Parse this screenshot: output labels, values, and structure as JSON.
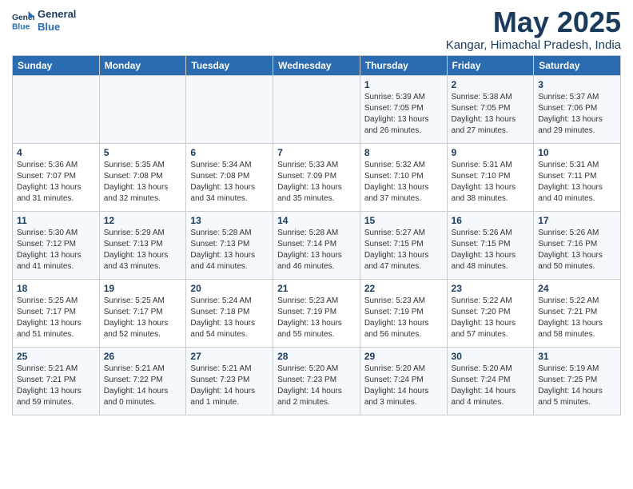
{
  "logo": {
    "line1": "General",
    "line2": "Blue"
  },
  "title": "May 2025",
  "location": "Kangar, Himachal Pradesh, India",
  "weekdays": [
    "Sunday",
    "Monday",
    "Tuesday",
    "Wednesday",
    "Thursday",
    "Friday",
    "Saturday"
  ],
  "weeks": [
    [
      {
        "day": "",
        "info": ""
      },
      {
        "day": "",
        "info": ""
      },
      {
        "day": "",
        "info": ""
      },
      {
        "day": "",
        "info": ""
      },
      {
        "day": "1",
        "info": "Sunrise: 5:39 AM\nSunset: 7:05 PM\nDaylight: 13 hours\nand 26 minutes."
      },
      {
        "day": "2",
        "info": "Sunrise: 5:38 AM\nSunset: 7:05 PM\nDaylight: 13 hours\nand 27 minutes."
      },
      {
        "day": "3",
        "info": "Sunrise: 5:37 AM\nSunset: 7:06 PM\nDaylight: 13 hours\nand 29 minutes."
      }
    ],
    [
      {
        "day": "4",
        "info": "Sunrise: 5:36 AM\nSunset: 7:07 PM\nDaylight: 13 hours\nand 31 minutes."
      },
      {
        "day": "5",
        "info": "Sunrise: 5:35 AM\nSunset: 7:08 PM\nDaylight: 13 hours\nand 32 minutes."
      },
      {
        "day": "6",
        "info": "Sunrise: 5:34 AM\nSunset: 7:08 PM\nDaylight: 13 hours\nand 34 minutes."
      },
      {
        "day": "7",
        "info": "Sunrise: 5:33 AM\nSunset: 7:09 PM\nDaylight: 13 hours\nand 35 minutes."
      },
      {
        "day": "8",
        "info": "Sunrise: 5:32 AM\nSunset: 7:10 PM\nDaylight: 13 hours\nand 37 minutes."
      },
      {
        "day": "9",
        "info": "Sunrise: 5:31 AM\nSunset: 7:10 PM\nDaylight: 13 hours\nand 38 minutes."
      },
      {
        "day": "10",
        "info": "Sunrise: 5:31 AM\nSunset: 7:11 PM\nDaylight: 13 hours\nand 40 minutes."
      }
    ],
    [
      {
        "day": "11",
        "info": "Sunrise: 5:30 AM\nSunset: 7:12 PM\nDaylight: 13 hours\nand 41 minutes."
      },
      {
        "day": "12",
        "info": "Sunrise: 5:29 AM\nSunset: 7:13 PM\nDaylight: 13 hours\nand 43 minutes."
      },
      {
        "day": "13",
        "info": "Sunrise: 5:28 AM\nSunset: 7:13 PM\nDaylight: 13 hours\nand 44 minutes."
      },
      {
        "day": "14",
        "info": "Sunrise: 5:28 AM\nSunset: 7:14 PM\nDaylight: 13 hours\nand 46 minutes."
      },
      {
        "day": "15",
        "info": "Sunrise: 5:27 AM\nSunset: 7:15 PM\nDaylight: 13 hours\nand 47 minutes."
      },
      {
        "day": "16",
        "info": "Sunrise: 5:26 AM\nSunset: 7:15 PM\nDaylight: 13 hours\nand 48 minutes."
      },
      {
        "day": "17",
        "info": "Sunrise: 5:26 AM\nSunset: 7:16 PM\nDaylight: 13 hours\nand 50 minutes."
      }
    ],
    [
      {
        "day": "18",
        "info": "Sunrise: 5:25 AM\nSunset: 7:17 PM\nDaylight: 13 hours\nand 51 minutes."
      },
      {
        "day": "19",
        "info": "Sunrise: 5:25 AM\nSunset: 7:17 PM\nDaylight: 13 hours\nand 52 minutes."
      },
      {
        "day": "20",
        "info": "Sunrise: 5:24 AM\nSunset: 7:18 PM\nDaylight: 13 hours\nand 54 minutes."
      },
      {
        "day": "21",
        "info": "Sunrise: 5:23 AM\nSunset: 7:19 PM\nDaylight: 13 hours\nand 55 minutes."
      },
      {
        "day": "22",
        "info": "Sunrise: 5:23 AM\nSunset: 7:19 PM\nDaylight: 13 hours\nand 56 minutes."
      },
      {
        "day": "23",
        "info": "Sunrise: 5:22 AM\nSunset: 7:20 PM\nDaylight: 13 hours\nand 57 minutes."
      },
      {
        "day": "24",
        "info": "Sunrise: 5:22 AM\nSunset: 7:21 PM\nDaylight: 13 hours\nand 58 minutes."
      }
    ],
    [
      {
        "day": "25",
        "info": "Sunrise: 5:21 AM\nSunset: 7:21 PM\nDaylight: 13 hours\nand 59 minutes."
      },
      {
        "day": "26",
        "info": "Sunrise: 5:21 AM\nSunset: 7:22 PM\nDaylight: 14 hours\nand 0 minutes."
      },
      {
        "day": "27",
        "info": "Sunrise: 5:21 AM\nSunset: 7:23 PM\nDaylight: 14 hours\nand 1 minute."
      },
      {
        "day": "28",
        "info": "Sunrise: 5:20 AM\nSunset: 7:23 PM\nDaylight: 14 hours\nand 2 minutes."
      },
      {
        "day": "29",
        "info": "Sunrise: 5:20 AM\nSunset: 7:24 PM\nDaylight: 14 hours\nand 3 minutes."
      },
      {
        "day": "30",
        "info": "Sunrise: 5:20 AM\nSunset: 7:24 PM\nDaylight: 14 hours\nand 4 minutes."
      },
      {
        "day": "31",
        "info": "Sunrise: 5:19 AM\nSunset: 7:25 PM\nDaylight: 14 hours\nand 5 minutes."
      }
    ]
  ]
}
